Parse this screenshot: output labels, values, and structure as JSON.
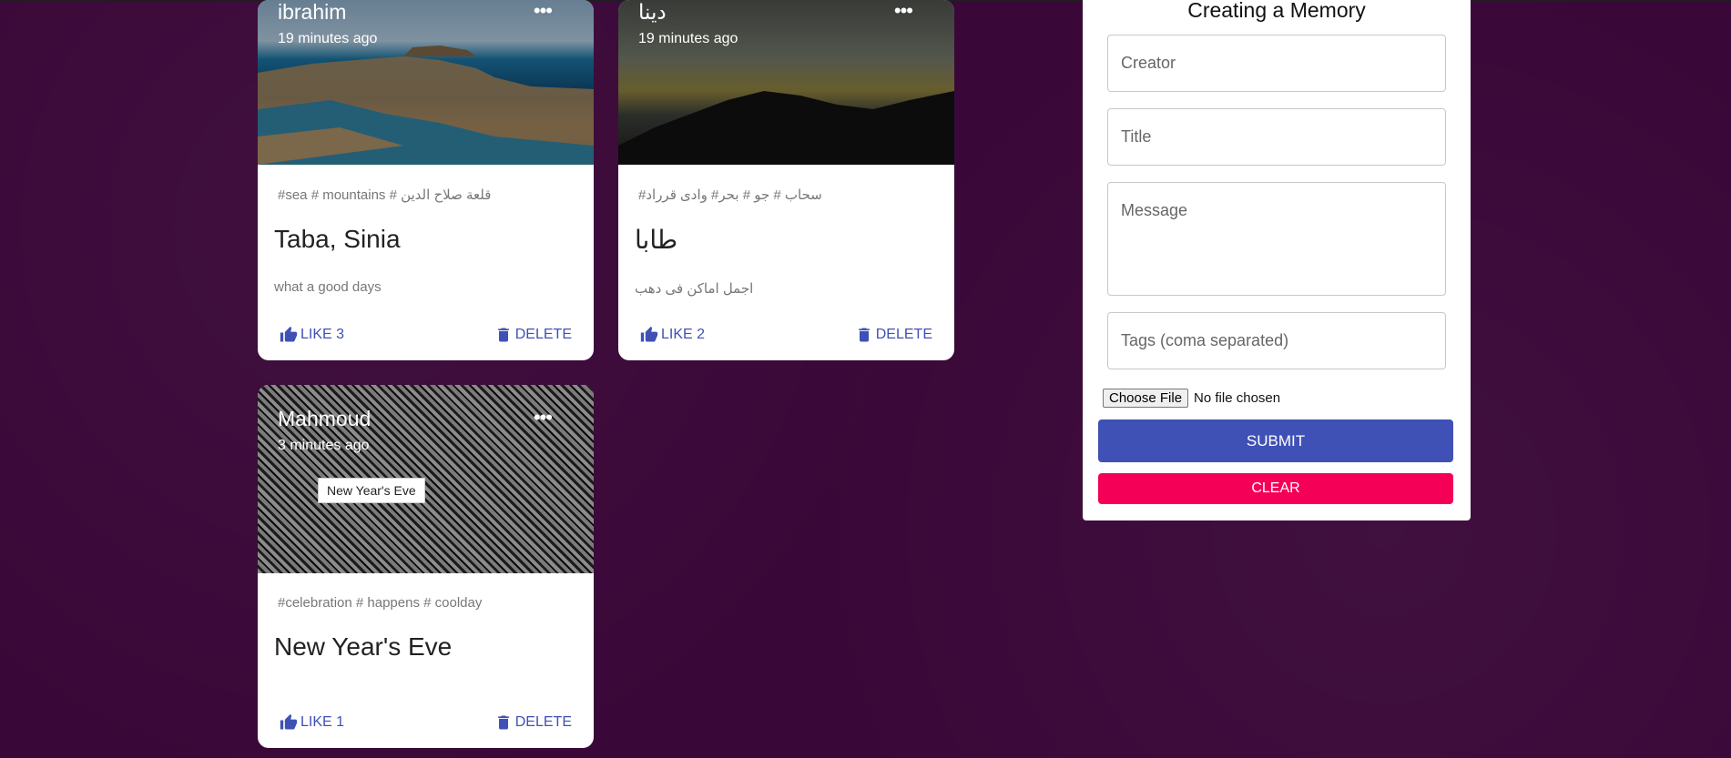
{
  "cards": [
    {
      "creator": "ibrahim",
      "time": "19 minutes ago",
      "tags": "#sea # mountains # قلعة صلاح الدين",
      "title": "Taba, Sinia",
      "message": "what a good days",
      "like_label": "LIKE 3",
      "delete_label": "DELETE"
    },
    {
      "creator": "دينا",
      "time": "19 minutes ago",
      "tags": "#سحاب # جو # بحر# وادى قرراد",
      "title": "طابا",
      "message": "اجمل اماكن فى دهب",
      "like_label": "LIKE 2",
      "delete_label": "DELETE"
    },
    {
      "creator": "Mahmoud",
      "time": "3 minutes ago",
      "tags": "#celebration # happens # coolday",
      "title": "New Year's Eve",
      "message": "",
      "like_label": "LIKE 1",
      "delete_label": "DELETE",
      "tooltip": "New Year's Eve"
    }
  ],
  "form": {
    "title": "Creating a Memory",
    "creator_label": "Creator",
    "title_label": "Title",
    "message_label": "Message",
    "tags_label": "Tags (coma separated)",
    "file_button": "Choose File",
    "file_status": "No file chosen",
    "submit_label": "SUBMIT",
    "clear_label": "CLEAR"
  },
  "colors": {
    "background": "#3a0838",
    "primary": "#3f51b5",
    "secondary": "#f50057"
  }
}
